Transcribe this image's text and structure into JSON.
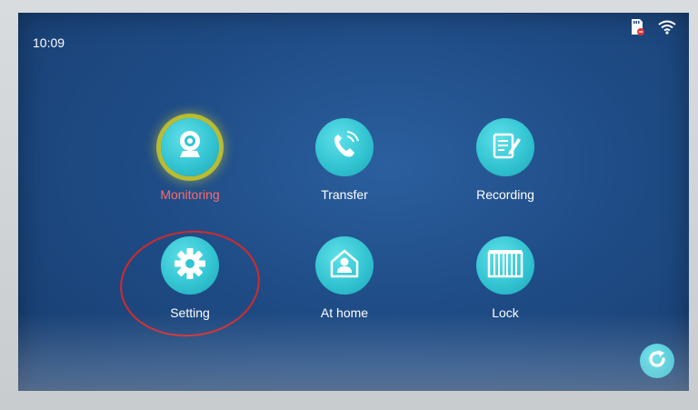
{
  "status_bar": {
    "time": "10:09",
    "icons": [
      "sd-card-icon",
      "wifi-icon"
    ]
  },
  "menu": {
    "items": [
      {
        "label": "Monitoring",
        "icon": "camera-icon",
        "selected": true
      },
      {
        "label": "Transfer",
        "icon": "phone-icon",
        "selected": false
      },
      {
        "label": "Recording",
        "icon": "notes-icon",
        "selected": false
      },
      {
        "label": "Setting",
        "icon": "gear-icon",
        "selected": false
      },
      {
        "label": "At home",
        "icon": "home-user-icon",
        "selected": false
      },
      {
        "label": "Lock",
        "icon": "gate-icon",
        "selected": false
      }
    ]
  },
  "footer": {
    "refresh_icon": "refresh-icon"
  },
  "colors": {
    "screen_bg": "#1f4c86",
    "icon_fill": "#33c4d2",
    "selected_label": "#ff6a6a",
    "selected_halo": "#c8c828",
    "annotation_ring": "#d42a2a"
  }
}
